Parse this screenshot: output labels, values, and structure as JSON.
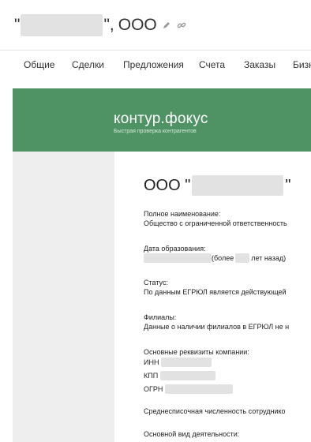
{
  "header": {
    "quote_open": "\"",
    "quote_close": "\",",
    "org_form": "ООО",
    "edit_icon": "pencil-icon",
    "link_icon": "link-icon"
  },
  "tabs": [
    "Общие",
    "Сделки",
    "Предложения",
    "Счета",
    "Заказы",
    "Бизн"
  ],
  "report": {
    "logo_text": "контур.фокус",
    "tagline": "Быстрая проверка контрагентов",
    "company_title_prefix": "ООО \"",
    "company_title_suffix": "\"",
    "full_name_label": "Полное наименование:",
    "full_name_value": "Общество с ограниченной ответственность",
    "founded_label": "Дата образования:",
    "founded_more": "(более",
    "founded_ago": "лет назад)",
    "status_label": "Статус:",
    "status_value": "По данным ЕГРЮЛ является действующей",
    "branches_label": "Филиалы:",
    "branches_value": "Данные о наличии филиалов в ЕГРЮЛ не н",
    "requisites_label": "Основные реквизиты компании:",
    "inn_label": "ИНН",
    "kpp_label": "КПП",
    "ogrn_label": "ОГРН",
    "headcount_label": "Среднесписочная численность сотруднико",
    "activity_label": "Основной вид деятельности:"
  },
  "colors": {
    "banner": "#4f9364",
    "redaction": "#e2e2e2"
  }
}
